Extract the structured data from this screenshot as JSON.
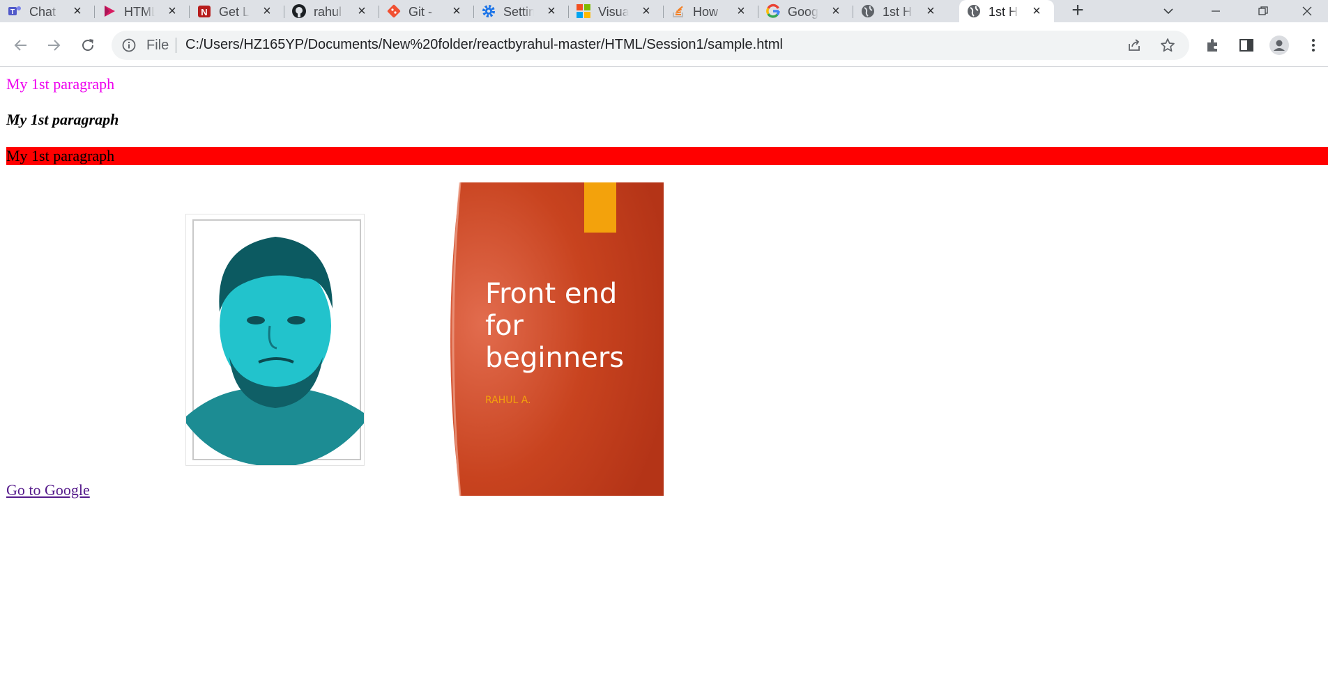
{
  "browser": {
    "tabs": [
      {
        "title": "Chat",
        "icon": "teams-icon",
        "active": false
      },
      {
        "title": "HTML",
        "icon": "play-icon",
        "active": false
      },
      {
        "title": "Get L",
        "icon": "n-logo-icon",
        "active": false
      },
      {
        "title": "rahul",
        "icon": "github-icon",
        "active": false
      },
      {
        "title": "Git -",
        "icon": "git-icon",
        "active": false
      },
      {
        "title": "Settin",
        "icon": "gear-icon",
        "active": false
      },
      {
        "title": "Visua",
        "icon": "windows-logo-icon",
        "active": false
      },
      {
        "title": "How",
        "icon": "stackoverflow-icon",
        "active": false
      },
      {
        "title": "Goog",
        "icon": "google-icon",
        "active": false
      },
      {
        "title": "1st H",
        "icon": "globe-icon",
        "active": false
      },
      {
        "title": "1st H",
        "icon": "globe-icon",
        "active": true
      }
    ],
    "address": {
      "scheme_label": "File",
      "url": "C:/Users/HZ165YP/Documents/New%20folder/reactbyrahul-master/HTML/Session1/sample.html"
    }
  },
  "page": {
    "paragraph_pink": "My 1st paragraph",
    "paragraph_bold_italic": "My 1st paragraph",
    "paragraph_red_bg": "My 1st paragraph",
    "cover": {
      "title_lines": [
        "Front end",
        "for",
        "beginners"
      ],
      "author": "RAHUL A."
    },
    "link_text": "Go to Google"
  },
  "colors": {
    "pink_text": "#ee00ee",
    "red_background": "#ff0000",
    "link_visited": "#551a8b",
    "cover_orange": "#c8431f",
    "cover_accent": "#f3a20c",
    "photo_tint": "#1fc6cf"
  }
}
